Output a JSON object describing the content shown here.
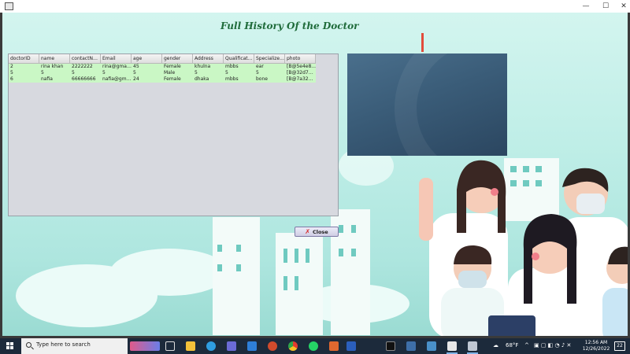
{
  "window": {
    "title": "",
    "controls": {
      "minimize": "—",
      "maximize": "☐",
      "close": "✕"
    }
  },
  "page_title": "Full History Of the Doctor",
  "table": {
    "columns": [
      "doctorID",
      "name",
      "contactNu...",
      "Email",
      "age",
      "gender",
      "Address",
      "Qualificatio...",
      "Specialize...",
      "photo"
    ],
    "rows": [
      [
        "2",
        "rina khan",
        "2222222",
        "rina@gmai...",
        "45",
        "Female",
        "khulna",
        "mbbs",
        "ear",
        "[B@5e4e8..."
      ],
      [
        "5",
        "5",
        "5",
        "5",
        "5",
        "Male",
        "5",
        "5",
        "5",
        "[B@32d78..."
      ],
      [
        "6",
        "nafia",
        "66666666",
        "nafia@gm...",
        "24",
        "Female",
        "dhaka",
        "mbbs",
        "bone",
        "[B@7a323..."
      ]
    ],
    "row_color": "#caf7c5"
  },
  "close_button": {
    "label": "Close",
    "icon": "close-x-icon"
  },
  "taskbar": {
    "search_placeholder": "Type here to search",
    "weather": "68°F",
    "time": "12:56 AM",
    "date": "12/26/2022",
    "notifications": "22",
    "apps": [
      "news-widget-icon",
      "task-view-icon",
      "file-explorer-icon",
      "edge-icon",
      "store-icon",
      "mail-icon",
      "powerpoint-icon",
      "chrome-icon",
      "whatsapp-icon",
      "office-icon",
      "word-icon",
      "terminal-icon",
      "network-app-icon",
      "photos-icon",
      "java-icon",
      "java-app-icon"
    ]
  }
}
